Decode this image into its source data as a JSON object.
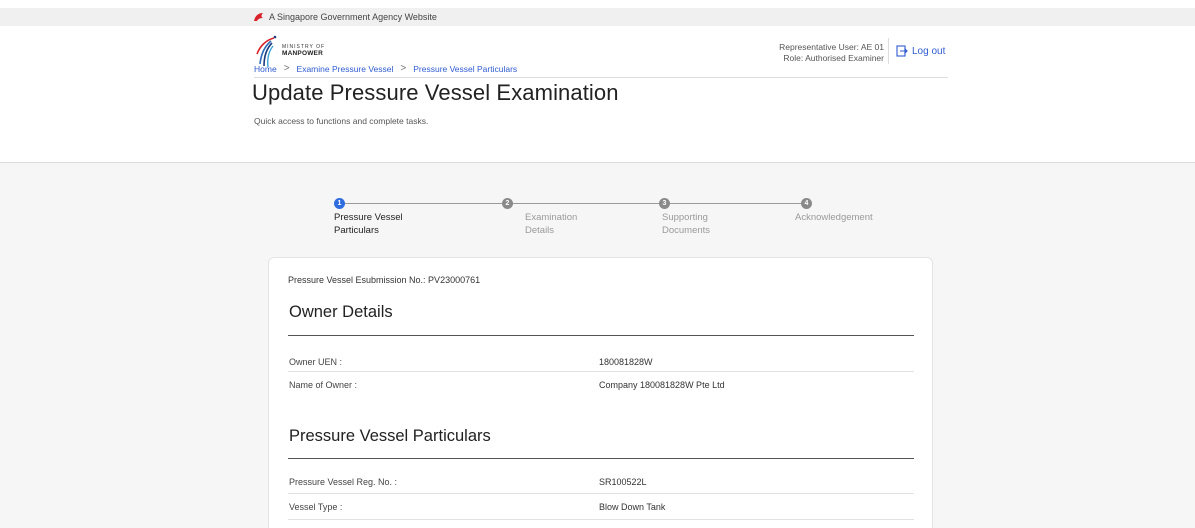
{
  "gov_banner": {
    "text": "A Singapore Government Agency Website"
  },
  "logo": {
    "line1": "MINISTRY OF",
    "line2": "MANPOWER"
  },
  "user": {
    "representative": "Representative User: AE 01",
    "role": "Role: Authorised Examiner",
    "logout_label": "Log out"
  },
  "breadcrumb": {
    "items": [
      "Home",
      "Examine Pressure Vessel",
      "Pressure Vessel Particulars"
    ],
    "separator": ">"
  },
  "page": {
    "title": "Update Pressure Vessel Examination",
    "subtitle": "Quick access to functions and complete tasks."
  },
  "stepper": {
    "steps": [
      {
        "number": "1",
        "line1": "Pressure Vessel",
        "line2": "Particulars",
        "state": "active"
      },
      {
        "number": "2",
        "line1": "Examination",
        "line2": "Details",
        "state": "inactive"
      },
      {
        "number": "3",
        "line1": "Supporting",
        "line2": "Documents",
        "state": "inactive"
      },
      {
        "number": "4",
        "line1": "Acknowledgement",
        "line2": "",
        "state": "inactive"
      }
    ]
  },
  "form": {
    "esubmission": "Pressure Vessel Esubmission No.: PV23000761",
    "owner_section": {
      "title": "Owner Details",
      "rows": [
        {
          "label": "Owner UEN :",
          "value": "180081828W"
        },
        {
          "label": "Name of Owner :",
          "value": "Company 180081828W Pte Ltd"
        }
      ]
    },
    "particulars_section": {
      "title": "Pressure Vessel Particulars",
      "rows": [
        {
          "label": "Pressure Vessel Reg. No. :",
          "value": "SR100522L"
        },
        {
          "label": "Vessel Type :",
          "value": "Blow Down Tank"
        }
      ]
    }
  },
  "colors": {
    "accent": "#2f5bd0",
    "step_active": "#2f6ddf",
    "step_inactive": "#8a8a8a",
    "lion_red": "#d8232a"
  }
}
